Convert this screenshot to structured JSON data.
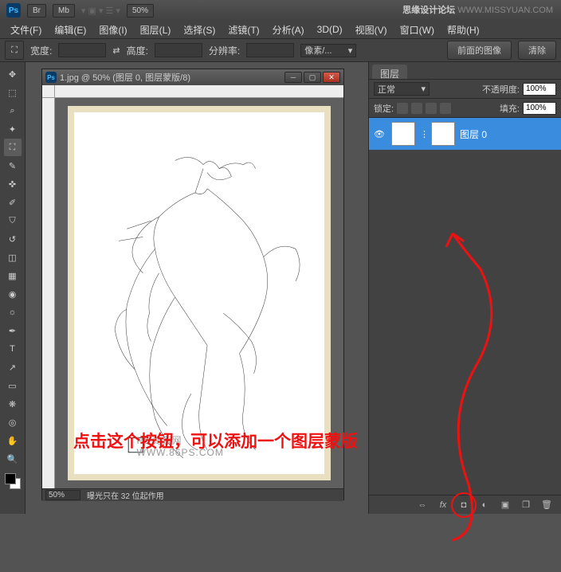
{
  "titlebar": {
    "btn1": "Br",
    "btn2": "Mb",
    "zoom": "50%"
  },
  "watermark": {
    "bold": "思缘设计论坛",
    "light": "WWW.MISSYUAN.COM"
  },
  "menu": [
    "文件(F)",
    "编辑(E)",
    "图像(I)",
    "图层(L)",
    "选择(S)",
    "滤镜(T)",
    "分析(A)",
    "3D(D)",
    "视图(V)",
    "窗口(W)",
    "帮助(H)"
  ],
  "optbar": {
    "width": "宽度:",
    "height": "高度:",
    "resolution": "分辨率:",
    "unit": "像素/...",
    "front": "前面的图像",
    "clear": "清除"
  },
  "doc": {
    "title": "1.jpg @ 50% (图层 0, 图层蒙版/8)",
    "zoom": "50%",
    "status": "曝光只在 32 位起作用"
  },
  "canvas_mark": "PS资源网  WWW.86PS.COM",
  "panel": {
    "tab": "图层",
    "blend": "正常",
    "opacity_label": "不透明度:",
    "opacity_val": "100%",
    "lock_label": "锁定:",
    "fill_label": "填充:",
    "fill_val": "100%"
  },
  "layers": [
    {
      "name": "图层 0"
    }
  ],
  "annotation": "点击这个按钮，可以添加一个图层蒙版"
}
